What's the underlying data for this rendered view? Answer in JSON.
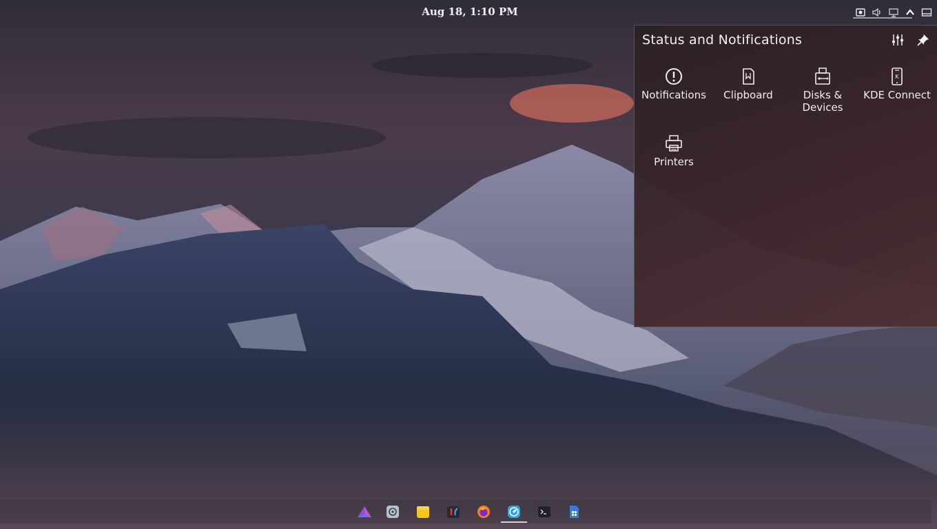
{
  "panel": {
    "clock": "Aug 18, 1:10 PM",
    "tray_icons": [
      "screenshot-icon",
      "volume-icon",
      "display-icon",
      "chevron-up-icon",
      "show-desktop-icon"
    ]
  },
  "popup": {
    "title": "Status and Notifications",
    "applets": [
      {
        "label": "Notifications",
        "icon": "notifications-icon"
      },
      {
        "label": "Clipboard",
        "icon": "clipboard-icon"
      },
      {
        "label": "Disks &\nDevices",
        "label_line1": "Disks &",
        "label_line2": "Devices",
        "icon": "usb-drive-icon"
      },
      {
        "label": "KDE Connect",
        "icon": "kde-connect-icon"
      },
      {
        "label": "Printers",
        "icon": "printer-icon"
      }
    ]
  },
  "dock": {
    "items": [
      "app-launcher-icon",
      "settings-icon",
      "files-icon",
      "paint-icon",
      "firefox-icon",
      "browser-icon",
      "terminal-icon",
      "document-icon"
    ],
    "active_index": 5
  },
  "colors": {
    "text": "#f0f0f0",
    "popup_bg": "#3a2a30",
    "indicator": "#cfd2d6"
  }
}
